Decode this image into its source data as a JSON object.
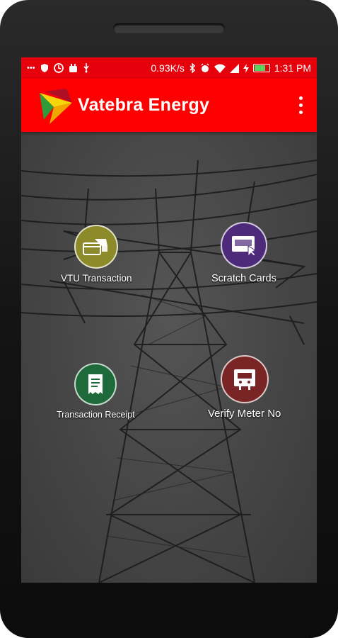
{
  "status_bar": {
    "network_speed": "0.93K/s",
    "time": "1:31 PM",
    "battery_level": 0.7,
    "left_icons": [
      "more-dots-icon",
      "shield-icon",
      "clock-icon",
      "robot-icon",
      "usb-icon"
    ],
    "right_icons": [
      "bluetooth-icon",
      "alarm-icon",
      "wifi-icon",
      "signal-icon",
      "charging-icon",
      "battery-icon"
    ]
  },
  "app_bar": {
    "title": "Vatebra Energy",
    "background_color": "#ff0000",
    "logo_colors": [
      "#f5d60a",
      "#2e9c3a",
      "#a0122a"
    ]
  },
  "menu": {
    "tiles": [
      {
        "label": "VTU Transaction",
        "icon": "card-hand-icon",
        "color": "#8c8a2a"
      },
      {
        "label": "Scratch Cards",
        "icon": "scratch-card-icon",
        "color": "#4e2a7a"
      },
      {
        "label": "Transaction Receipt",
        "icon": "receipt-icon",
        "color": "#1f6a3a"
      },
      {
        "label": "Verify Meter No",
        "icon": "meter-icon",
        "color": "#7a2525"
      }
    ]
  }
}
